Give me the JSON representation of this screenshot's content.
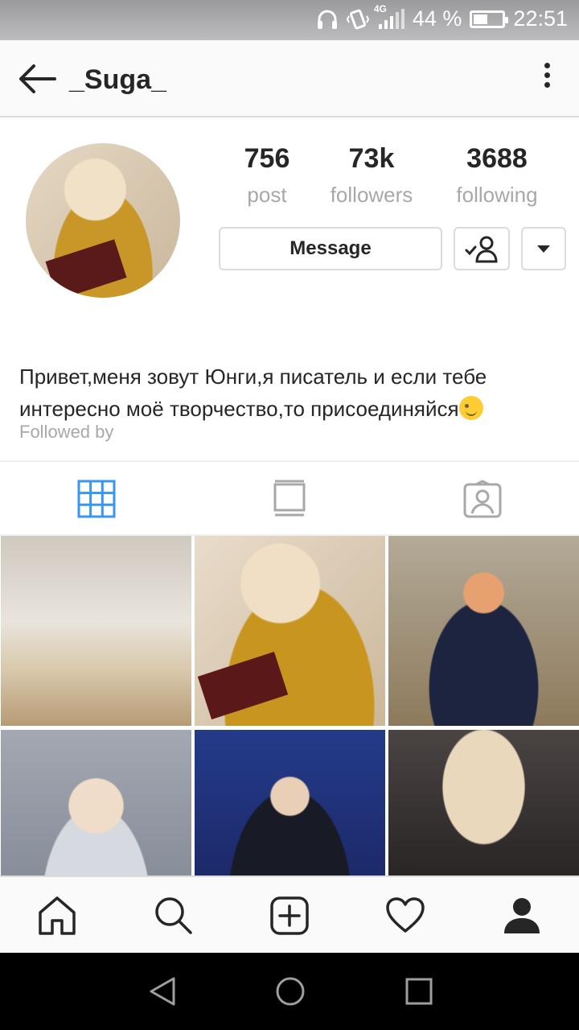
{
  "status_bar": {
    "network": "4G",
    "battery_percent_label": "44 %",
    "battery_level": 0.44,
    "time": "22:51",
    "icons": [
      "headphones-icon",
      "vibrate-icon",
      "signal-icon",
      "battery-icon"
    ]
  },
  "header": {
    "username": "_Suga_",
    "icons": [
      "back-arrow-icon",
      "more-vertical-icon"
    ]
  },
  "profile": {
    "stats": [
      {
        "value": "756",
        "label": "post"
      },
      {
        "value": "73k",
        "label": "followers"
      },
      {
        "value": "3688",
        "label": "following"
      }
    ],
    "message_label": "Message",
    "follow_icon": "following-check-user-icon",
    "dropdown_icon": "caret-down-icon",
    "bio": "Привет,меня зовут Юнги,я писатель и если тебе интересно моё творчество,то присоединяйся",
    "bio_emoji": "wink-face-emoji",
    "followed_by": "Followed by"
  },
  "tabs": [
    {
      "icon": "grid-icon",
      "active": true
    },
    {
      "icon": "feed-list-icon",
      "active": false
    },
    {
      "icon": "tagged-person-icon",
      "active": false
    }
  ],
  "photos": [
    "photo-1",
    "photo-2",
    "photo-3",
    "photo-4",
    "photo-5",
    "photo-6"
  ],
  "bottom_nav": [
    "home-icon",
    "search-icon",
    "add-post-icon",
    "heart-icon",
    "profile-icon"
  ],
  "system_nav": [
    "back-triangle-icon",
    "home-circle-icon",
    "recents-square-icon"
  ],
  "colors": {
    "accent": "#3897f0",
    "text": "#262626",
    "muted": "#a8a8a8",
    "border": "#dbdbdb"
  }
}
